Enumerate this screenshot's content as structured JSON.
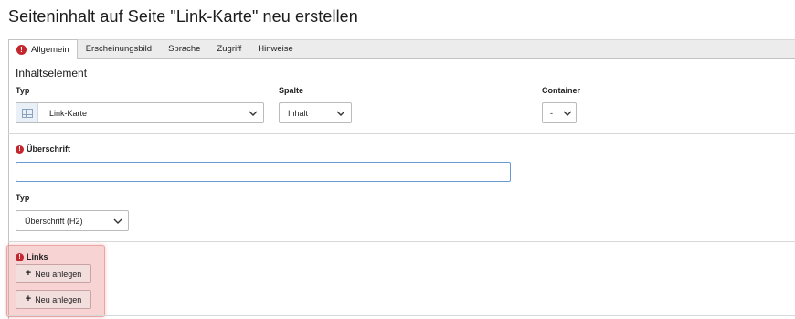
{
  "page": {
    "title": "Seiteninhalt auf Seite \"Link-Karte\" neu erstellen"
  },
  "tabs": [
    {
      "label": "Allgemein",
      "active": true,
      "error": true
    },
    {
      "label": "Erscheinungsbild"
    },
    {
      "label": "Sprache"
    },
    {
      "label": "Zugriff"
    },
    {
      "label": "Hinweise"
    }
  ],
  "content_element": {
    "section_title": "Inhaltselement",
    "type_label": "Typ",
    "type_value": "Link-Karte",
    "column_label": "Spalte",
    "column_value": "Inhalt",
    "container_label": "Container",
    "container_value": "-"
  },
  "heading": {
    "label": "Überschrift",
    "value": "",
    "type_label": "Typ",
    "type_value": "Überschrift (H2)"
  },
  "links": {
    "label": "Links",
    "buttons": [
      "Neu anlegen",
      "Neu anlegen"
    ]
  },
  "colors": {
    "error": "#c4262e",
    "focus_border": "#6a9bd0",
    "highlight": "#eb8282"
  }
}
